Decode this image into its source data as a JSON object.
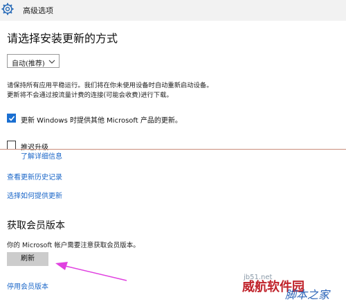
{
  "window": {
    "title": "高级选项"
  },
  "update_method": {
    "heading": "请选择安装更新的方式",
    "select_value": "自动(推荐)",
    "description": "请保持所有应用平稳运行。我们将在你未使用设备时自动重新启动设备。更新将不会通过按流量计费的连接(可能会收费)进行下载。"
  },
  "options": {
    "checkbox1_label": "更新 Windows 时提供其他 Microsoft 产品的更新。",
    "checkbox2_label": "推迟升级",
    "link_details": "了解详细信息",
    "link_history": "查看更新历史记录",
    "link_delivery": "选择如何提供更新"
  },
  "insider": {
    "heading": "获取会员版本",
    "description": "你的 Microsoft 帐户需要注意获取会员版本。",
    "refresh_button": "刷新",
    "stop_link": "停用会员版本"
  },
  "watermark": {
    "small": "jb51.net",
    "main": "威航软件园",
    "sub": "脚本之家"
  },
  "colors": {
    "accent": "#1a6fd1",
    "link": "#1a66c8",
    "annotation_arrow": "#e040e0"
  }
}
